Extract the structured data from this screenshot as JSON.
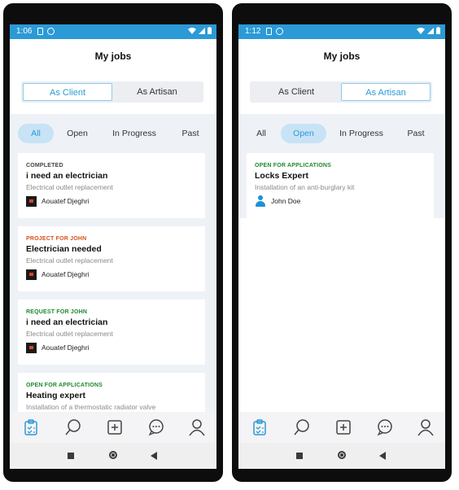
{
  "colors": {
    "accent": "#2b9ad6",
    "completed": "#444444",
    "project": "#d4531c",
    "request": "#1e8a2e",
    "open": "#1e8a2e"
  },
  "left": {
    "status_time": "1:06",
    "title": "My jobs",
    "segments": [
      "As Client",
      "As Artisan"
    ],
    "active_segment": 0,
    "filters": [
      "All",
      "Open",
      "In Progress",
      "Past"
    ],
    "active_filter": 0,
    "cards": [
      {
        "tag": "COMPLETED",
        "tag_color": "completed",
        "title": "i need an electrician",
        "desc": "Electrical outlet replacement",
        "user": "Aouatef Djeghri",
        "avatar": "photo"
      },
      {
        "tag": "PROJECT FOR JOHN",
        "tag_color": "project",
        "title": "Electrician needed",
        "desc": "Electrical outlet replacement",
        "user": "Aouatef Djeghri",
        "avatar": "photo"
      },
      {
        "tag": "REQUEST FOR JOHN",
        "tag_color": "request",
        "title": "i need an electrician",
        "desc": "Electrical outlet replacement",
        "user": "Aouatef Djeghri",
        "avatar": "photo"
      },
      {
        "tag": "OPEN FOR APPLICATIONS",
        "tag_color": "open",
        "title": "Heating expert",
        "desc": "Installation of a thermostatic radiator valve",
        "user": "",
        "avatar": "none"
      }
    ]
  },
  "right": {
    "status_time": "1:12",
    "title": "My jobs",
    "segments": [
      "As Client",
      "As Artisan"
    ],
    "active_segment": 1,
    "filters": [
      "All",
      "Open",
      "In Progress",
      "Past"
    ],
    "active_filter": 1,
    "cards": [
      {
        "tag": "OPEN FOR APPLICATIONS",
        "tag_color": "open",
        "title": "Locks Expert",
        "desc": "Installation of an anti-burglary kit",
        "user": "John Doe",
        "avatar": "person"
      }
    ]
  },
  "tabs": [
    "jobs-clipboard-icon",
    "search-icon",
    "add-square-icon",
    "chat-bubbles-icon",
    "profile-icon"
  ]
}
